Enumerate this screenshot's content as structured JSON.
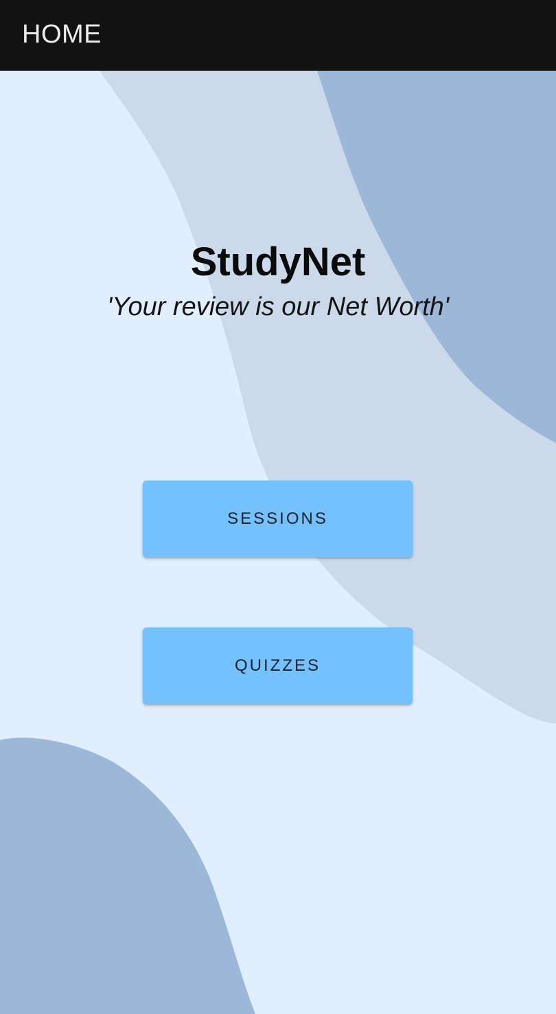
{
  "app_bar": {
    "title": "HOME"
  },
  "main": {
    "app_name": "StudyNet",
    "tagline": "'Your review is our Net Worth'"
  },
  "buttons": {
    "sessions_label": "SESSIONS",
    "quizzes_label": "QUIZZES"
  },
  "colors": {
    "app_bar_background": "#121212",
    "page_background": "#e1eefd",
    "blob_light": "#cbd9ea",
    "blob_dark": "#9db7d8",
    "button_background": "#75c1fd"
  }
}
